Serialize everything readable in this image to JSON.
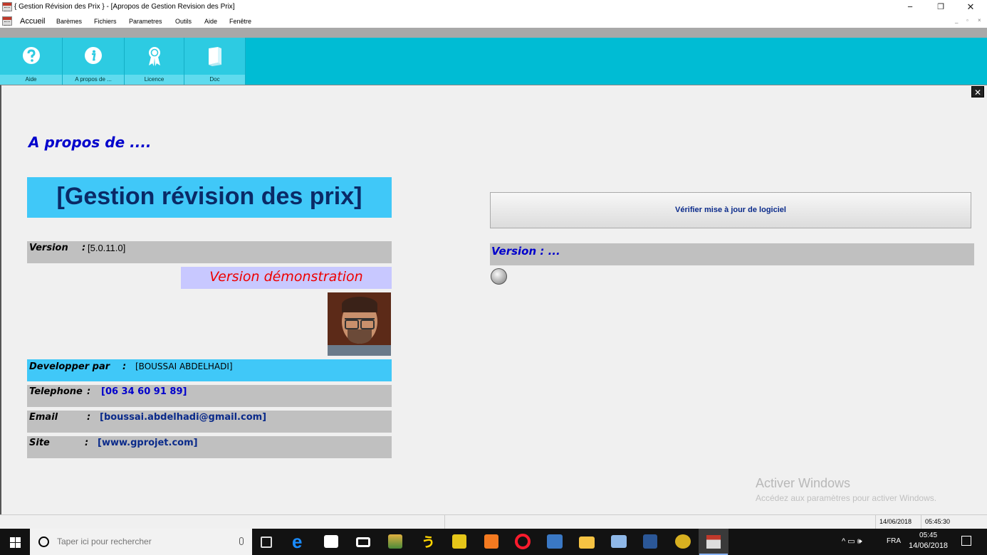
{
  "window": {
    "title": "{   Gestion Révision des Prix  } - [Apropos de Gestion Revision des Prix]",
    "min": "−",
    "restore": "❐",
    "close": "✕"
  },
  "menu": {
    "items": [
      "Accueil",
      "Barèmes",
      "Fichiers",
      "Parametres",
      "Outils",
      "Aide",
      "Fenêtre"
    ],
    "mdi": [
      "_",
      "▫",
      "×"
    ]
  },
  "ribbon": {
    "buttons": [
      {
        "label": "Aide",
        "icon": "question-icon"
      },
      {
        "label": "A propos de ...",
        "icon": "info-icon"
      },
      {
        "label": "Licence",
        "icon": "ribbon-award-icon"
      },
      {
        "label": "Doc",
        "icon": "book-icon"
      }
    ]
  },
  "about": {
    "close": "✕",
    "heading": "A propos de ....",
    "product": "[Gestion révision des prix]",
    "version_key": "Version",
    "version_sep": ":",
    "version_value": "[5.0.11.0]",
    "demo": "Version démonstration",
    "dev_key": "Developper par",
    "dev_sep": ":",
    "dev_value": "[BOUSSAI  ABDELHADI]",
    "tel_key": "Telephone",
    "tel_sep": ":",
    "tel_value": "[06 34 60 91 89]",
    "email_key": "Email",
    "email_sep": ":",
    "email_value": "[boussai.abdelhadi@gmail.com]",
    "site_key": "Site",
    "site_sep": ":",
    "site_value": "[www.gprojet.com]"
  },
  "update": {
    "button": "Vérifier mise à jour de logiciel",
    "remote_version": "Version  :  ..."
  },
  "watermark": {
    "line1": "Activer Windows",
    "line2": "Accédez aux paramètres pour activer Windows."
  },
  "statusbar": {
    "date": "14/06/2018",
    "time": "05:45:30"
  },
  "taskbar": {
    "search_placeholder": "Taper ici pour rechercher",
    "lang": "FRA",
    "time": "05:45",
    "date": "14/06/2018",
    "tray_symbols": "^  ▭  🕪"
  },
  "colors": {
    "ribbon": "#00bcd4",
    "banner": "#40c8f8",
    "heading": "#0000cc",
    "demo": "#ee0000"
  }
}
